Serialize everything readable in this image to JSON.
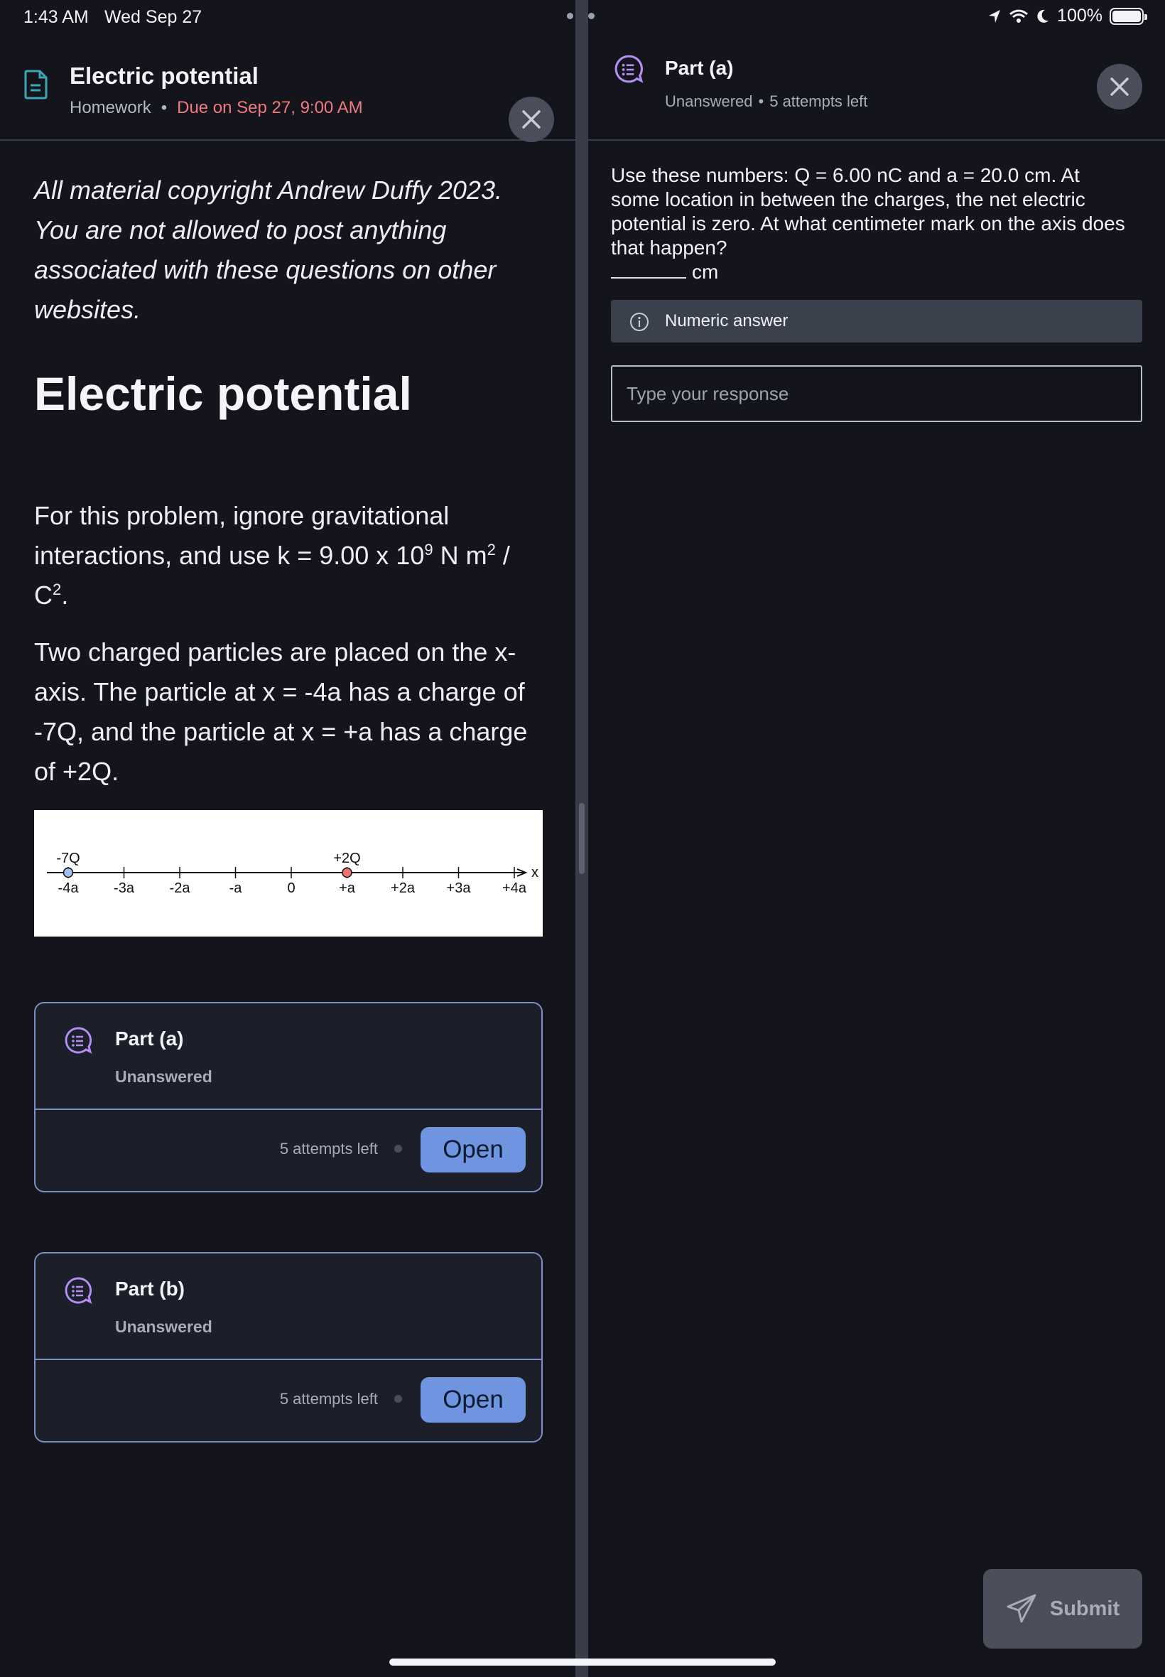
{
  "status_bar": {
    "time": "1:43 AM",
    "date": "Wed Sep 27",
    "battery": "100%",
    "battery_level": 1.0,
    "icons": [
      "location-arrow-icon",
      "wifi-icon",
      "moon-icon",
      "battery-icon"
    ]
  },
  "left": {
    "header": {
      "title": "Electric potential",
      "type": "Homework",
      "separator": "•",
      "due": "Due on Sep 27, 9:00 AM"
    },
    "copyright": "All material copyright Andrew Duffy 2023. You are not allowed to post anything associated with these questions on other websites.",
    "page_title": "Electric potential",
    "para1_pre": "For this problem, ignore gravitational interactions, and use k = 9.00 x 10",
    "para1_sup1": "9",
    "para1_mid": " N m",
    "para1_sup2": "2",
    "para1_mid2": " / C",
    "para1_sup3": "2",
    "para1_end": ".",
    "para2": "Two charged particles are placed on the x-axis. The particle at x = -4a has a charge of -7Q, and the particle at x = +a has a charge of +2Q.",
    "figure": {
      "ticks": [
        "-4a",
        "-3a",
        "-2a",
        "-a",
        "0",
        "+a",
        "+2a",
        "+3a",
        "+4a"
      ],
      "axis_label": "x",
      "charges": [
        {
          "label": "-7Q",
          "position": "-4a",
          "color": "#9ec0ef"
        },
        {
          "label": "+2Q",
          "position": "+a",
          "color": "#f07070"
        }
      ]
    },
    "parts": [
      {
        "title": "Part (a)",
        "status": "Unanswered",
        "attempts": "5 attempts left",
        "button": "Open"
      },
      {
        "title": "Part (b)",
        "status": "Unanswered",
        "attempts": "5 attempts left",
        "button": "Open"
      }
    ]
  },
  "right": {
    "header": {
      "title": "Part (a)",
      "status": "Unanswered",
      "separator": "•",
      "attempts": "5 attempts left"
    },
    "question": "Use these numbers: Q = 6.00 nC and a = 20.0 cm. At some location in between the charges, the net electric potential is zero. At what centimeter mark on the axis does that happen?",
    "unit": "cm",
    "answer_type": "Numeric answer",
    "input_placeholder": "Type your response",
    "submit": "Submit"
  },
  "colors": {
    "background": "#14151c",
    "accent_blue": "#6f95e0",
    "due_red": "#f07a7e",
    "card_border": "#7c8fc2",
    "icon_purple": "#b28ef0"
  }
}
